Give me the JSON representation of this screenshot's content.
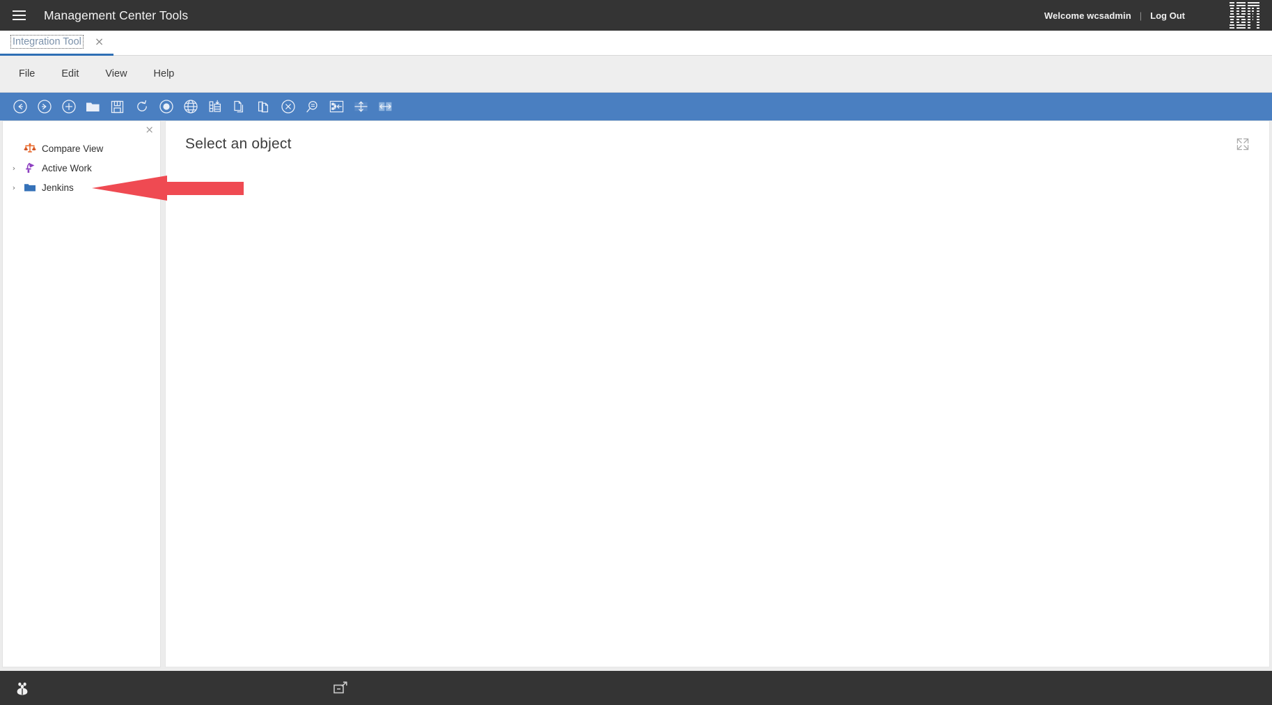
{
  "header": {
    "menu_icon": "hamburger-menu-icon",
    "title": "Management Center Tools",
    "welcome": "Welcome wcsadmin",
    "separator": "|",
    "logout": "Log Out",
    "logo": "IBM",
    "bg_color": "#343434"
  },
  "tab_bar": {
    "tabs": [
      {
        "label": "Integration Tool",
        "close": "×",
        "active": true
      }
    ],
    "active_underline_color": "#2f6fb5"
  },
  "menu_bar": {
    "items": [
      {
        "label": "File"
      },
      {
        "label": "Edit"
      },
      {
        "label": "View"
      },
      {
        "label": "Help"
      }
    ]
  },
  "toolbar": {
    "bg_color": "#4a7fc1",
    "buttons": [
      {
        "name": "back-icon",
        "title": "Back"
      },
      {
        "name": "forward-icon",
        "title": "Forward"
      },
      {
        "name": "new-icon",
        "title": "New"
      },
      {
        "name": "open-folder-icon",
        "title": "Open"
      },
      {
        "name": "save-icon",
        "title": "Save"
      },
      {
        "name": "refresh-icon",
        "title": "Refresh"
      },
      {
        "name": "stop-icon",
        "title": "Stop"
      },
      {
        "name": "globe-icon",
        "title": "Globe"
      },
      {
        "name": "properties-icon",
        "title": "Properties"
      },
      {
        "name": "copy-icon",
        "title": "Copy"
      },
      {
        "name": "paste-icon",
        "title": "Paste"
      },
      {
        "name": "cancel-icon",
        "title": "Cancel"
      },
      {
        "name": "find-icon",
        "title": "Find"
      },
      {
        "name": "collapse-tree-icon",
        "title": "Collapse Tree"
      },
      {
        "name": "resize-vertical-icon",
        "title": "Resize Vertical"
      },
      {
        "name": "resize-horizontal-icon",
        "title": "Resize Horizontal"
      }
    ]
  },
  "side_panel": {
    "close_label": "×",
    "tree_items": [
      {
        "label": "Compare View",
        "icon": "compare-balance-icon",
        "icon_color": "#e8682a",
        "has_children": false,
        "chevron": "›"
      },
      {
        "label": "Active Work",
        "icon": "active-work-icon",
        "icon_color": "#8d3fc0",
        "has_children": true,
        "chevron": "›"
      },
      {
        "label": "Jenkins",
        "icon": "folder-icon",
        "icon_color": "#3571b8",
        "has_children": true,
        "chevron": "›"
      }
    ]
  },
  "content_panel": {
    "title": "Select an object",
    "expand_icon": "expand-fullscreen-icon"
  },
  "annotation": {
    "arrow": "red-left-arrow",
    "color": "#ef4a52"
  },
  "footer": {
    "bg_color": "#343434",
    "buttons": [
      {
        "name": "debug-bug-icon",
        "title": "Debug"
      },
      {
        "name": "popout-window-icon",
        "title": "Pop out"
      }
    ]
  }
}
